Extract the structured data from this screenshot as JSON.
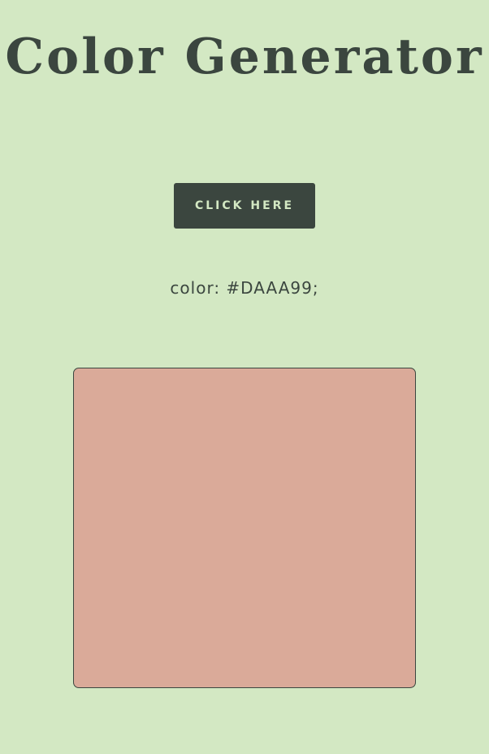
{
  "header": {
    "title": "Color Generator"
  },
  "controls": {
    "button_label": "CLICK HERE"
  },
  "output": {
    "color_text": "color: #DAAA99;",
    "swatch_color": "#DAAA99"
  },
  "theme": {
    "background": "#d3e8c3",
    "dark": "#3b463f"
  }
}
